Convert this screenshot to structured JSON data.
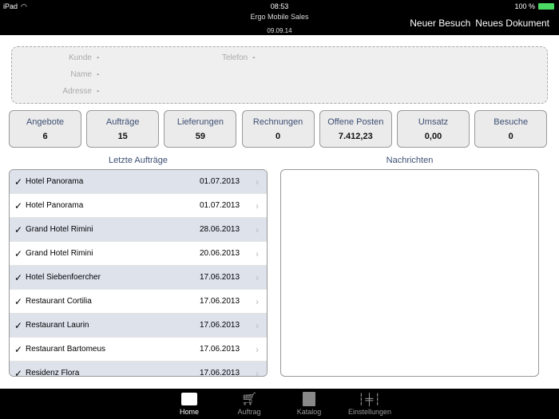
{
  "status": {
    "device": "iPad",
    "time": "08:53",
    "battery": "100 %"
  },
  "header": {
    "app": "Ergo Mobile Sales",
    "date": "09.09.14",
    "new_visit": "Neuer Besuch",
    "new_document": "Neues Dokument"
  },
  "customer": {
    "kunde_label": "Kunde",
    "kunde": "-",
    "name_label": "Name",
    "name": "-",
    "adresse_label": "Adresse",
    "adresse": "-",
    "telefon_label": "Telefon",
    "telefon": "-"
  },
  "stats": [
    {
      "label": "Angebote",
      "value": "6"
    },
    {
      "label": "Aufträge",
      "value": "15"
    },
    {
      "label": "Lieferungen",
      "value": "59"
    },
    {
      "label": "Rechnungen",
      "value": "0"
    },
    {
      "label": "Offene Posten",
      "value": "7.412,23"
    },
    {
      "label": "Umsatz",
      "value": "0,00"
    },
    {
      "label": "Besuche",
      "value": "0"
    }
  ],
  "orders_title": "Letzte Aufträge",
  "messages_title": "Nachrichten",
  "orders": [
    {
      "name": "Hotel Panorama",
      "date": "01.07.2013"
    },
    {
      "name": "Hotel Panorama",
      "date": "01.07.2013"
    },
    {
      "name": "Grand Hotel Rimini",
      "date": "28.06.2013"
    },
    {
      "name": "Grand Hotel Rimini",
      "date": "20.06.2013"
    },
    {
      "name": "Hotel Siebenfoercher",
      "date": "17.06.2013"
    },
    {
      "name": "Restaurant Cortilia",
      "date": "17.06.2013"
    },
    {
      "name": "Restaurant Laurin",
      "date": "17.06.2013"
    },
    {
      "name": "Restaurant Bartomeus",
      "date": "17.06.2013"
    },
    {
      "name": "Residenz Flora",
      "date": "17.06.2013"
    }
  ],
  "tabs": [
    {
      "label": "Home",
      "icon": "home-icon"
    },
    {
      "label": "Auftrag",
      "icon": "cart-icon"
    },
    {
      "label": "Katalog",
      "icon": "book-icon"
    },
    {
      "label": "Einstellungen",
      "icon": "sliders-icon"
    }
  ]
}
